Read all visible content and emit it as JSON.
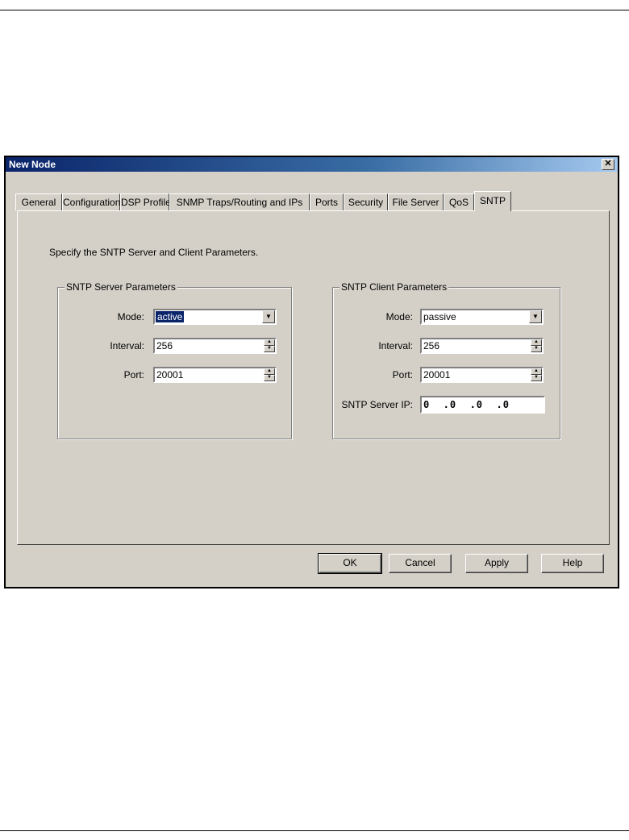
{
  "window": {
    "title": "New Node",
    "close_glyph": "✕"
  },
  "tabs": [
    "General",
    "Configuration",
    "DSP Profile",
    "SNMP Traps/Routing and IPs",
    "Ports",
    "Security",
    "File Server",
    "QoS",
    "SNTP"
  ],
  "active_tab": "SNTP",
  "intro": "Specify the SNTP Server and Client Parameters.",
  "server": {
    "legend": "SNTP Server Parameters",
    "mode_label": "Mode:",
    "mode_value": "active",
    "interval_label": "Interval:",
    "interval_value": "256",
    "port_label": "Port:",
    "port_value": "20001"
  },
  "client": {
    "legend": "SNTP Client Parameters",
    "mode_label": "Mode:",
    "mode_value": "passive",
    "interval_label": "Interval:",
    "interval_value": "256",
    "port_label": "Port:",
    "port_value": "20001",
    "ip_label": "SNTP Server IP:",
    "ip_value": "0  .0  .0  .0"
  },
  "buttons": {
    "ok": "OK",
    "cancel": "Cancel",
    "apply": "Apply",
    "help": "Help"
  },
  "icons": {
    "dropdown": "chevron-down-icon",
    "spinner": "spin-arrows-icon",
    "close": "close-icon"
  },
  "colors": {
    "titlebar": "#0a246a",
    "face": "#d4d0c8",
    "selection": "#0a246a"
  }
}
